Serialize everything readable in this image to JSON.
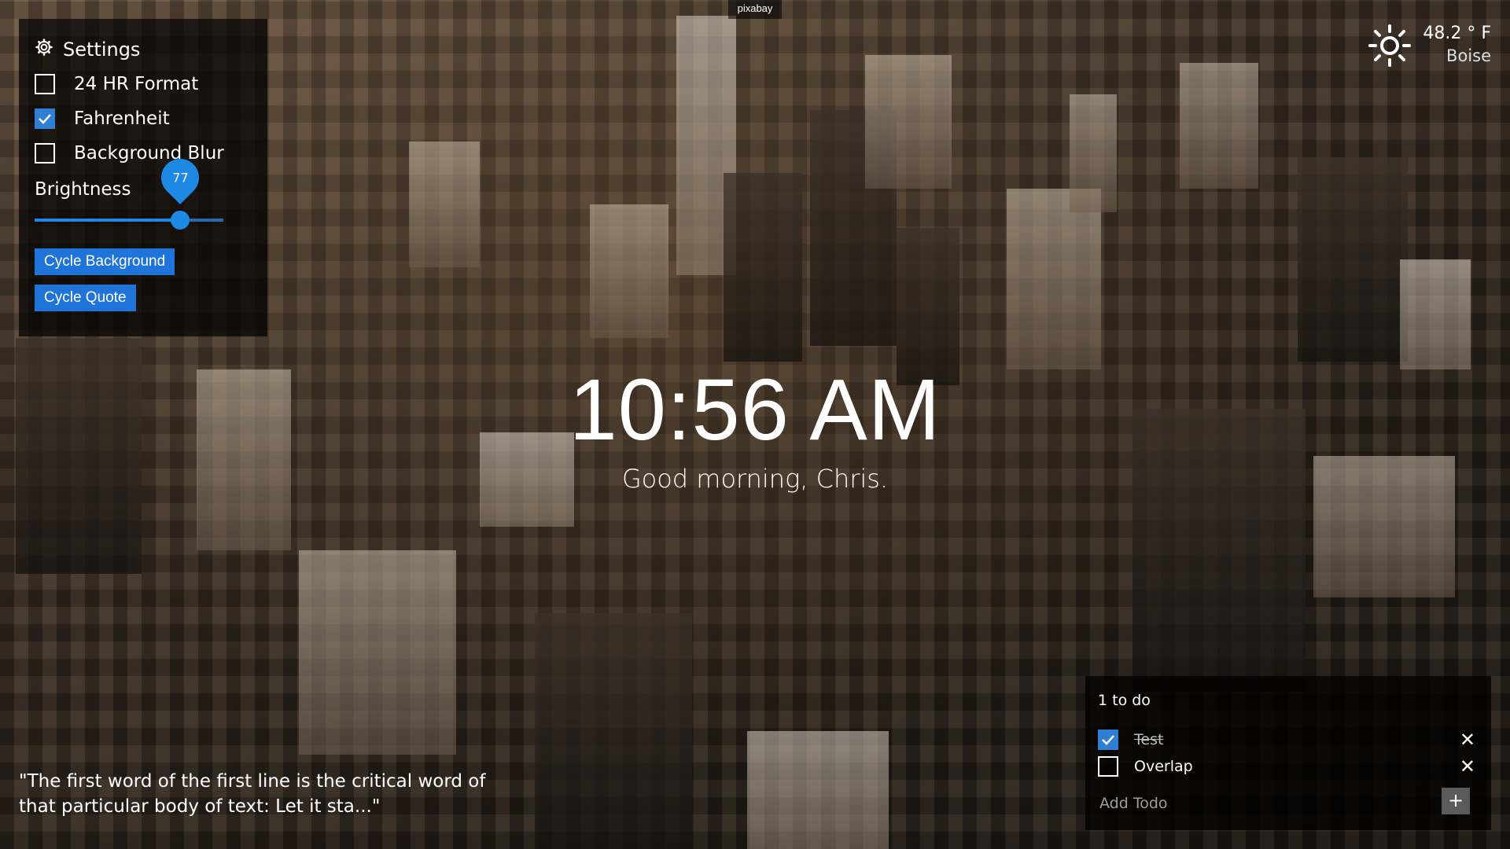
{
  "credit": "pixabay",
  "settings": {
    "title": "Settings",
    "options": [
      {
        "label": "24 HR Format",
        "checked": false
      },
      {
        "label": "Fahrenheit",
        "checked": true
      },
      {
        "label": "Background Blur",
        "checked": false
      }
    ],
    "brightness_label": "Brightness",
    "brightness_value": "77",
    "brightness_percent": 77,
    "cycle_background": "Cycle Background",
    "cycle_quote": "Cycle Quote"
  },
  "weather": {
    "temperature": "48.2 ° F",
    "city": "Boise",
    "icon": "sun-icon"
  },
  "clock": {
    "time": "10:56 AM",
    "greeting": "Good morning, Chris."
  },
  "quote": "\"The first word of the first line is the critical word of that particular body of text: Let it sta...\"",
  "todo": {
    "count": "1 to do",
    "items": [
      {
        "text": "Test",
        "done": true
      },
      {
        "text": "Overlap",
        "done": false
      }
    ],
    "add_placeholder": "Add Todo",
    "add_button": "+"
  },
  "colors": {
    "accent": "#1e88e5",
    "button": "#1e74d8",
    "panel": "rgba(0,0,0,0.72)"
  }
}
